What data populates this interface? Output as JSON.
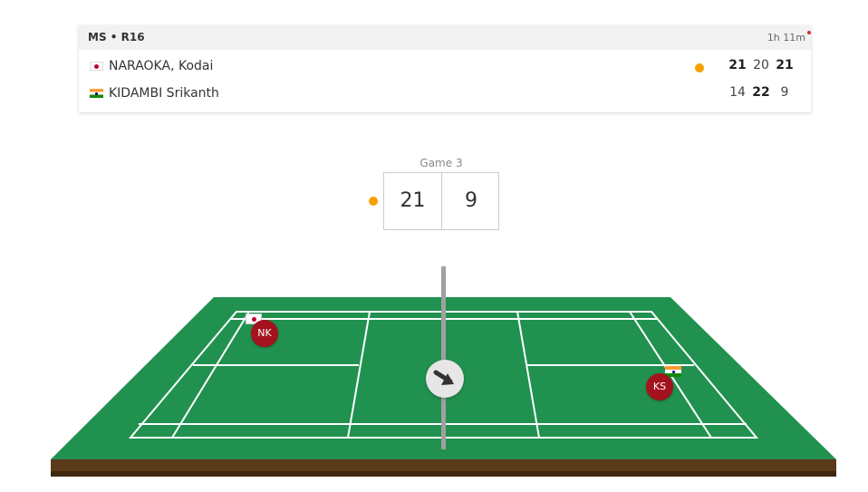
{
  "match": {
    "event": "MS • R16",
    "duration": "1h 11m",
    "players": [
      {
        "name": "NARAOKA, Kodai",
        "country": "japan",
        "initials": "NK",
        "serving": true,
        "games": [
          {
            "score": "21",
            "won": true
          },
          {
            "score": "20",
            "won": false
          },
          {
            "score": "21",
            "won": true
          }
        ]
      },
      {
        "name": "KIDAMBI Srikanth",
        "country": "india",
        "initials": "KS",
        "serving": false,
        "games": [
          {
            "score": "14",
            "won": false
          },
          {
            "score": "22",
            "won": true
          },
          {
            "score": "9",
            "won": false
          }
        ]
      }
    ]
  },
  "current_game": {
    "label": "Game 3",
    "left_score": "21",
    "right_score": "9"
  },
  "court": {
    "shuttle_direction": "right-down-arrow-icon"
  },
  "colors": {
    "court": "#21914f",
    "court_base": "#5a3a18",
    "serve_indicator": "#f5a000",
    "player_token": "#a3121d",
    "header_bg": "#f2f2f2"
  }
}
